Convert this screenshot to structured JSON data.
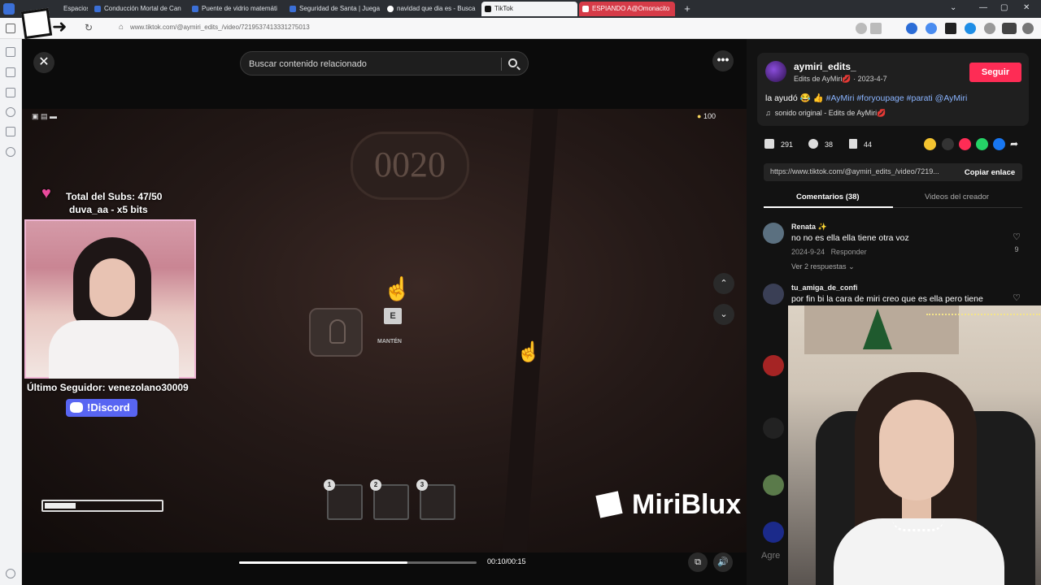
{
  "browser": {
    "tabs": [
      {
        "label": "Espacios"
      },
      {
        "label": "Conducción Mortal de Can"
      },
      {
        "label": "Puente de vidrio matemáti"
      },
      {
        "label": "Seguridad de Santa | Juega"
      },
      {
        "label": "navidad que dia es - Busca"
      },
      {
        "label": "TikTok"
      },
      {
        "label": "ESPIANDO A@Omonacito"
      }
    ],
    "url": "www.tiktok.com/@aymiri_edits_/video/7219537413331275013"
  },
  "video": {
    "search_placeholder": "Buscar contenido relacionado",
    "door_number": "0020",
    "hud_coins": "100",
    "hud_e_key": "E",
    "hud_hold_label": "MANTÉN",
    "overlay_subs_line1": "Total del Subs: 47/50",
    "overlay_subs_line2": "duva_aa - x5 bits",
    "overlay_follower": "Último Seguidor: venezolano30009",
    "overlay_discord": "!Discord",
    "slots": [
      "1",
      "2",
      "3"
    ],
    "watermark": "MiriBlux",
    "health_fraction": 0.27,
    "progress_fraction": 0.71,
    "time": "00:10/00:15"
  },
  "panel": {
    "username": "aymiri_edits_",
    "display_name": "Edits de AyMiri💋",
    "date": "2023-4-7",
    "follow_label": "Seguir",
    "caption_text": "la ayudó 😂 👍",
    "caption_tags": "#AyMiri #foryoupage #parati @AyMiri",
    "music": "sonido original - Edits de AyMiri💋",
    "likes": "291",
    "comments_count": "38",
    "saves": "44",
    "link": "https://www.tiktok.com/@aymiri_edits_/video/7219...",
    "copy_label": "Copiar enlace",
    "tab_comments": "Comentarios (38)",
    "tab_creator": "Videos del creador",
    "comments": [
      {
        "name": "Renata ✨",
        "text": "no no es ella ella tiene otra voz",
        "date": "2024-9-24",
        "reply": "Responder",
        "replies": "Ver 2 respuestas",
        "likes": "9"
      },
      {
        "name": "tu_amiga_de_confi",
        "text": "por fin bi la cara de miri creo que es ella pero tiene"
      }
    ],
    "add_comment_placeholder": "Agre"
  },
  "colors": {
    "accent": "#fe2c55",
    "link": "#8ab4ff",
    "panel_bg": "#121212"
  }
}
